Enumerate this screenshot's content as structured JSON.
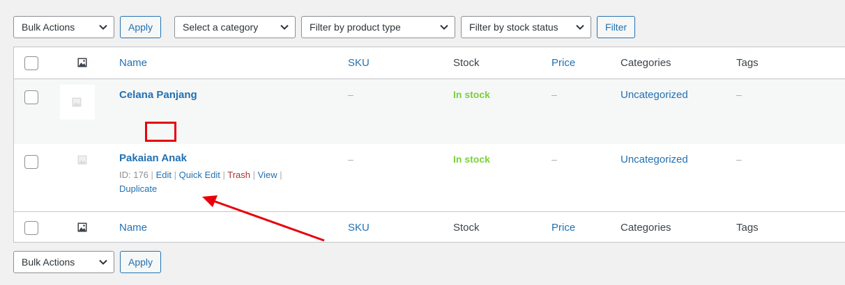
{
  "toolbar": {
    "bulk_actions": "Bulk Actions",
    "apply": "Apply",
    "category_select": "Select a category",
    "product_type_select": "Filter by product type",
    "stock_status_select": "Filter by stock status",
    "filter": "Filter"
  },
  "columns": {
    "name": "Name",
    "sku": "SKU",
    "stock": "Stock",
    "price": "Price",
    "categories": "Categories",
    "tags": "Tags"
  },
  "rows": [
    {
      "name": "Celana Panjang",
      "sku": "–",
      "stock": "In stock",
      "price": "–",
      "categories": "Uncategorized",
      "tags": "–"
    },
    {
      "name": "Pakaian Anak",
      "sku": "–",
      "stock": "In stock",
      "price": "–",
      "categories": "Uncategorized",
      "tags": "–",
      "row_actions": {
        "id_label": "ID: 176",
        "edit": "Edit",
        "quick_edit": "Quick Edit",
        "trash": "Trash",
        "view": "View",
        "duplicate": "Duplicate",
        "separator": "|"
      }
    }
  ],
  "footer_toolbar": {
    "bulk_actions": "Bulk Actions",
    "apply": "Apply"
  },
  "colors": {
    "link": "#2271b1",
    "in_stock": "#7ad03a",
    "trash": "#b32d2e",
    "annotation": "#e8000b"
  }
}
